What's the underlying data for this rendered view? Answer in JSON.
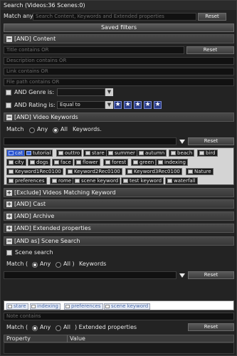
{
  "window": {
    "title": "Search (Videos:36 Scenes:0)"
  },
  "match_any": {
    "label": "Match any:",
    "placeholder": "Search Content, Keywords and Extended properties",
    "reset": "Reset"
  },
  "saved_filters": "Saved filters",
  "content_section": {
    "header": "[AND] Content",
    "title_placeholder": "Title contains OR",
    "title_reset": "Reset",
    "description_placeholder": "Description contains OR",
    "link_placeholder": "Link contains OR",
    "filepath_placeholder": "File path contains OR",
    "genre_label": "AND Genre is:",
    "genre_value": "",
    "rating_label": "AND Rating is:",
    "rating_operator": "Equal to",
    "rating_stars": 5
  },
  "video_keywords": {
    "header": "[AND] Video Keywords",
    "match_label": "Match",
    "any_label": "Any",
    "all_label": "All",
    "keywords_label": "Keywords.",
    "reset": "Reset",
    "tags_row1": [
      "cat",
      "tutorial",
      "outtro",
      "stare",
      "summer",
      "autumn",
      "beach",
      "bird"
    ],
    "tags_row2": [
      "city",
      "dogs",
      "face",
      "flower",
      "forest",
      "green",
      "indexing"
    ],
    "tags_row3": [
      "Keyword1Rec0100",
      "Keyword2Rec0100",
      "Keyword3Rec0100",
      "Nature"
    ],
    "tags_row4": [
      "preferences",
      "rome",
      "scene keyword",
      "test keyword",
      "waterfall"
    ]
  },
  "collapsed_sections": [
    "[Exclude] Videos Matching Keyword",
    "[AND] Cast",
    "[AND] Archive",
    "[AND] Extended properties"
  ],
  "scene_search": {
    "header": "[AND as] Scene Search",
    "checkbox_label": "Scene search",
    "match_label": "Match (",
    "any_label": "Any",
    "all_label": "All )",
    "keywords_label": "Keywords",
    "reset": "Reset",
    "tags": [
      "stare",
      "indexing",
      "preferences",
      "scene keyword"
    ],
    "note_placeholder": "Note contains",
    "ext_match_label": "Match (",
    "ext_any_label": "Any",
    "ext_all_label": "All",
    "ext_label": ") Extended properties",
    "ext_reset": "Reset",
    "grid_columns": [
      "Property",
      "Value"
    ]
  }
}
